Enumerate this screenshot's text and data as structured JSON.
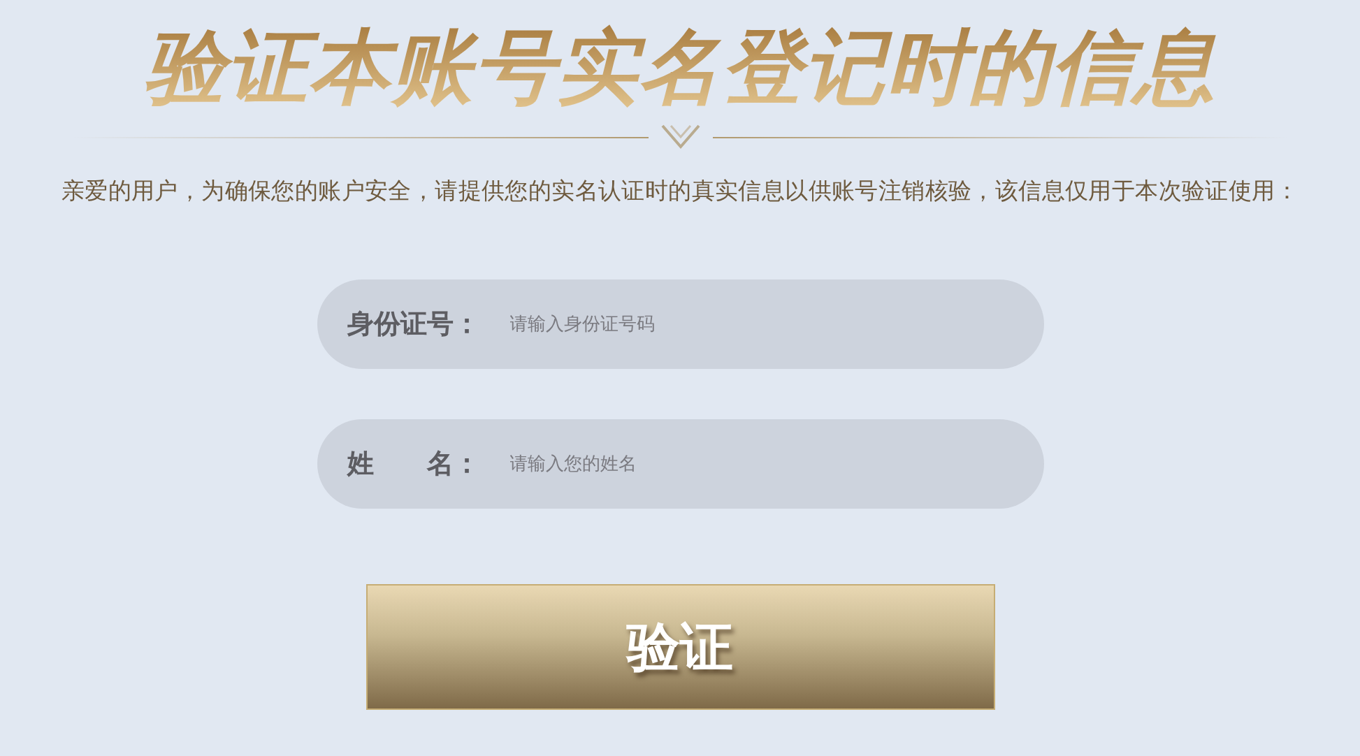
{
  "title": "验证本账号实名登记时的信息",
  "notice": "亲爱的用户，为确保您的账户安全，请提供您的实名认证时的真实信息以供账号注销核验，该信息仅用于本次验证使用：",
  "fields": [
    {
      "label": "身份证号：",
      "placeholder": "请输入身份证号码"
    },
    {
      "label": "姓　　名：",
      "placeholder": "请输入您的姓名"
    }
  ],
  "button": "验证"
}
